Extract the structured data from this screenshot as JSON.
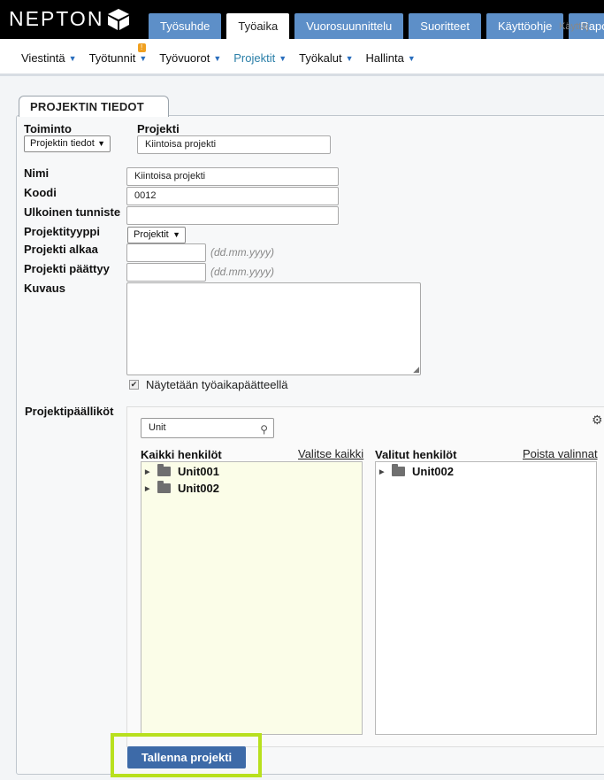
{
  "brand": {
    "name": "NEPTON",
    "logo_icon": "cube-logo-icon"
  },
  "main_tabs": [
    "Työsuhde",
    "Työaika",
    "Vuorosuunnittelu",
    "Suoritteet",
    "Käyttöohje",
    "Rapo"
  ],
  "active_main_tab": "Työaika",
  "user_text": "Käyttäj",
  "subnav": [
    {
      "label": "Viestintä"
    },
    {
      "label": "Työtunnit",
      "badge": "!"
    },
    {
      "label": "Työvuorot"
    },
    {
      "label": "Projektit",
      "active": true
    },
    {
      "label": "Työkalut"
    },
    {
      "label": "Hallinta"
    }
  ],
  "panel": {
    "title": "PROJEKTIN TIEDOT"
  },
  "form": {
    "toiminto_label": "Toiminto",
    "toiminto_value": "Projektin tiedot",
    "projekti_label": "Projekti",
    "projekti_value": "Kiintoisa projekti",
    "nimi_label": "Nimi",
    "nimi_value": "Kiintoisa projekti",
    "koodi_label": "Koodi",
    "koodi_value": "0012",
    "ulkoinen_label": "Ulkoinen tunniste",
    "ulkoinen_value": "",
    "tyyppi_label": "Projektityyppi",
    "tyyppi_value": "Projektit",
    "alkaa_label": "Projekti alkaa",
    "alkaa_value": "",
    "alkaa_hint": "(dd.mm.yyyy)",
    "paattyy_label": "Projekti päättyy",
    "paattyy_value": "",
    "paattyy_hint": "(dd.mm.yyyy)",
    "kuvaus_label": "Kuvaus",
    "kuvaus_value": "",
    "checkbox_label": "Näytetään työaikapäätteellä",
    "checkbox_checked": true,
    "managers_label": "Projektipäälliköt"
  },
  "managers": {
    "search_value": "Unit",
    "all_header": "Kaikki henkilöt",
    "select_all": "Valitse kaikki",
    "all_items": [
      "Unit001",
      "Unit002"
    ],
    "selected_header": "Valitut henkilöt",
    "remove_selected": "Poista valinnat",
    "selected_items": [
      "Unit002"
    ]
  },
  "save_button": "Tallenna projekti",
  "colors": {
    "tab_blue": "#5d8fc8",
    "highlight": "#b8e01e",
    "save_btn": "#3d6aa8"
  }
}
